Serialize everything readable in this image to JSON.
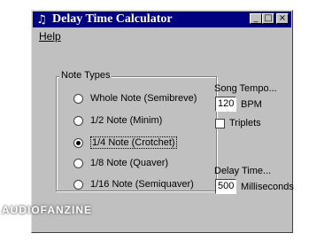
{
  "window": {
    "title": "Delay Time Calculator",
    "icon": "music-note-icon"
  },
  "titlebar": {
    "minimize": "_",
    "maximize": "□",
    "close": "×"
  },
  "menu": {
    "items": [
      {
        "label": "Help"
      }
    ]
  },
  "note_types": {
    "title": "Note Types",
    "options": [
      {
        "label": "Whole Note (Semibreve)",
        "selected": false
      },
      {
        "label": "1/2 Note (Minim)",
        "selected": false
      },
      {
        "label": "1/4 Note (Crotchet)",
        "selected": true
      },
      {
        "label": "1/8 Note (Quaver)",
        "selected": false
      },
      {
        "label": "1/16 Note (Semiquaver)",
        "selected": false
      }
    ]
  },
  "tempo": {
    "label": "Song Tempo...",
    "value": "120",
    "unit": "BPM"
  },
  "triplets": {
    "label": "Triplets",
    "checked": false
  },
  "delay": {
    "label": "Delay Time...",
    "value": "500",
    "unit": "Milliseconds"
  },
  "watermark": {
    "text": "AUDIOFANZINE"
  }
}
